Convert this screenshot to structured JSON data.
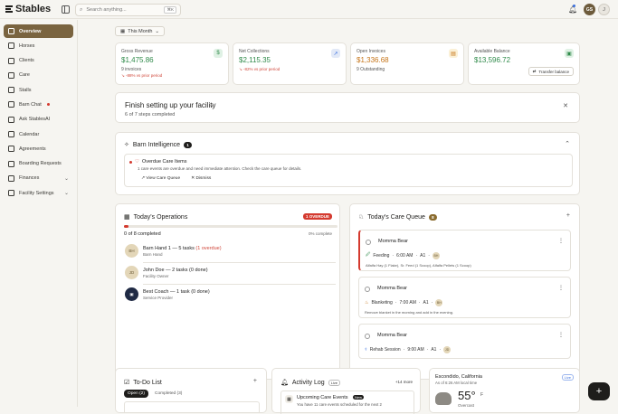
{
  "app": {
    "name": "Stables"
  },
  "search": {
    "placeholder": "Search anything...",
    "shortcut": "⌘K"
  },
  "user": {
    "initials": "GS",
    "alt_initial": "J"
  },
  "sidebar": {
    "items": [
      {
        "label": "Overview",
        "icon": "overview-icon",
        "active": true
      },
      {
        "label": "Horses",
        "icon": "horse-icon"
      },
      {
        "label": "Clients",
        "icon": "clients-icon"
      },
      {
        "label": "Care",
        "icon": "care-icon"
      },
      {
        "label": "Stalls",
        "icon": "stalls-icon"
      },
      {
        "label": "Barn Chat",
        "icon": "chat-icon",
        "dot": true
      },
      {
        "label": "Ask StablesAI",
        "icon": "ai-icon"
      },
      {
        "label": "Calendar",
        "icon": "calendar-icon"
      },
      {
        "label": "Agreements",
        "icon": "agreements-icon"
      },
      {
        "label": "Boarding Requests",
        "icon": "boarding-icon"
      },
      {
        "label": "Finances",
        "icon": "finances-icon",
        "chevron": true
      },
      {
        "label": "Facility Settings",
        "icon": "settings-icon",
        "chevron": true
      }
    ]
  },
  "period": {
    "label": "This Month"
  },
  "stats": [
    {
      "label": "Gross Revenue",
      "value": "$1,475.86",
      "sub": "9 invoices",
      "change": "↘ -88% vs prior period",
      "badge": "$"
    },
    {
      "label": "Net Collections",
      "value": "$2,115.35",
      "change": "↘ -82% vs prior period",
      "badge": "↗"
    },
    {
      "label": "Open Invoices",
      "value": "$1,336.68",
      "sub": "9 Outstanding",
      "badge": "▤"
    },
    {
      "label": "Available Balance",
      "value": "$13,596.72",
      "button": "Transfer balance",
      "badge": "▣"
    }
  ],
  "setup": {
    "title": "Finish setting up your facility",
    "subtitle": "6 of 7 steps completed"
  },
  "intelligence": {
    "title": "Barn Intelligence",
    "count": "1",
    "item_title": "Overdue Care Items",
    "item_desc": "1 care events are overdue and need immediate attention. Check the care queue for details.",
    "view": "View Care Queue",
    "dismiss": "Dismiss"
  },
  "operations": {
    "title": "Today's Operations",
    "badge": "1 OVERDUE",
    "progress_text": "0 of 8 completed",
    "progress_pct": "0% complete",
    "progress_fraction": 0.02,
    "rows": [
      {
        "initials": "BH",
        "name": "Barn Hand 1 — 5 tasks",
        "overdue": " (1 overdue)",
        "role": "Barn Hand"
      },
      {
        "initials": "JD",
        "name": "John Doe — 2 tasks",
        "overdue": " (0 done)",
        "role": "Facility Owner"
      },
      {
        "initials": "▣",
        "name": "Best Coach — 1 task",
        "overdue": " (0 done)",
        "role": "Service Provider"
      }
    ]
  },
  "care_queue": {
    "title": "Today's Care Queue",
    "count": "8",
    "items": [
      {
        "horse": "Momma Bear",
        "type": "Feeding",
        "time": "6:00 AM",
        "stall": "A1",
        "who": "BH",
        "note": "Alfalfa Hay (1 Flake), Sr. Feed (1 Scoop), Alfalfa Pellets (1 Scoop)",
        "overdue": true
      },
      {
        "horse": "Momma Bear",
        "type": "Blanketing",
        "time": "7:00 AM",
        "stall": "A1",
        "who": "BH",
        "note": "Remove blanket in the morning and add in the evening."
      },
      {
        "horse": "Momma Bear",
        "type": "Rehab Session",
        "time": "9:00 AM",
        "stall": "A1",
        "who": "JD",
        "note": ""
      }
    ]
  },
  "todo": {
    "title": "To-Do List",
    "tab_open": "Open (2)",
    "tab_done": "Completed (3)"
  },
  "activity": {
    "title": "Activity Log",
    "live": "Live",
    "more": "+14 more",
    "item_title": "Upcoming Care Events",
    "item_badge": "New",
    "item_desc": "You have 11 care events scheduled for the next 2"
  },
  "weather": {
    "location": "Escondido, California",
    "asof": "As of 6:26 AM local time",
    "temp": "55°",
    "unit": "F",
    "cond": "Overcast",
    "live": "Live"
  },
  "colors": {
    "accent": "#7a6440",
    "positive": "#2f8a4a",
    "negative": "#d0473a",
    "warn": "#c67418"
  }
}
